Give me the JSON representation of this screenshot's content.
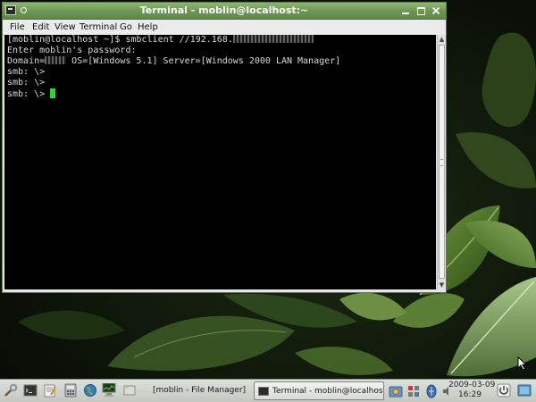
{
  "window": {
    "title": "Terminal - moblin@localhost:~"
  },
  "menu": {
    "file": "File",
    "edit": "Edit",
    "view": "View",
    "terminal": "Terminal",
    "go": "Go",
    "help": "Help"
  },
  "terminal": {
    "line0_prefix": "[moblin@localhost ~]$ smbclient //192.168.",
    "line1": "Enter moblin's password:",
    "line2_prefix": "Domain=",
    "line2_suffix": " OS=[Windows 5.1] Server=[Windows 2000 LAN Manager]",
    "line3": "smb: \\>",
    "line4": "smb: \\>",
    "line5": "smb: \\> ",
    "cursor_color": "#22e022"
  },
  "taskbar": {
    "launchers": [
      "tools-icon",
      "terminal-icon",
      "text-editor-icon",
      "calculator-icon",
      "web-browser-icon",
      "system-monitor-icon",
      "file-manager-icon"
    ],
    "tasks": {
      "file_manager": "[moblin - File Manager]",
      "terminal": "Terminal - moblin@localhost:~"
    },
    "clock": {
      "date": "2009-03-09",
      "time": "16:29"
    }
  },
  "colors": {
    "titlebar": "#6b9652",
    "terminal_bg": "#000000",
    "terminal_fg": "#d8d8d8",
    "panel": "#d0d4cd"
  }
}
